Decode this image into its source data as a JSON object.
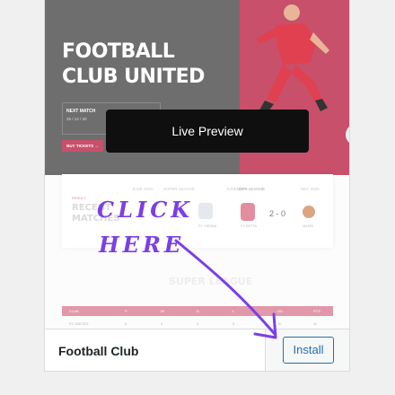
{
  "theme_preview": {
    "hero": {
      "title_line1": "FOOTBALL",
      "title_line2": "CLUB UNITED",
      "next_match_label": "NEXT MATCH",
      "next_match_date": "25 / 12 / 20",
      "tickets_label": "BUY TICKETS →",
      "colors": {
        "left": "#6e6e6e",
        "right": "#c8506b"
      }
    },
    "matches": {
      "tag": "RESULT",
      "title_line1": "RECENT",
      "title_line2": "MATCHES",
      "league_left": "SUPER LEAGUE",
      "date_left": "JUNE 2020",
      "score_left": "2",
      "team_left": "FC VIENNA",
      "league_right": "UEFA LEAGUE",
      "date_right_prefix": "JUNE 2020",
      "date_right": "MAY 2020",
      "score_right": "2 - 0",
      "team_right_a": "FC BETTA",
      "team_right_b": "MADRI"
    },
    "standings": {
      "heading": "SUPER LEAGUE",
      "header_cells": [
        "CLUB",
        "P",
        "W",
        "D",
        "L",
        "GD",
        "PTS"
      ],
      "row_cells": [
        "FC UNITED",
        "5",
        "3",
        "2",
        "0",
        "10",
        "11"
      ]
    }
  },
  "tooltip": {
    "label": "Live Preview"
  },
  "footer": {
    "theme_name": "Football Club",
    "install_label": "Install"
  },
  "annotation": {
    "line1": "CLICK",
    "line2": "HERE",
    "color": "#7b3fe4"
  }
}
